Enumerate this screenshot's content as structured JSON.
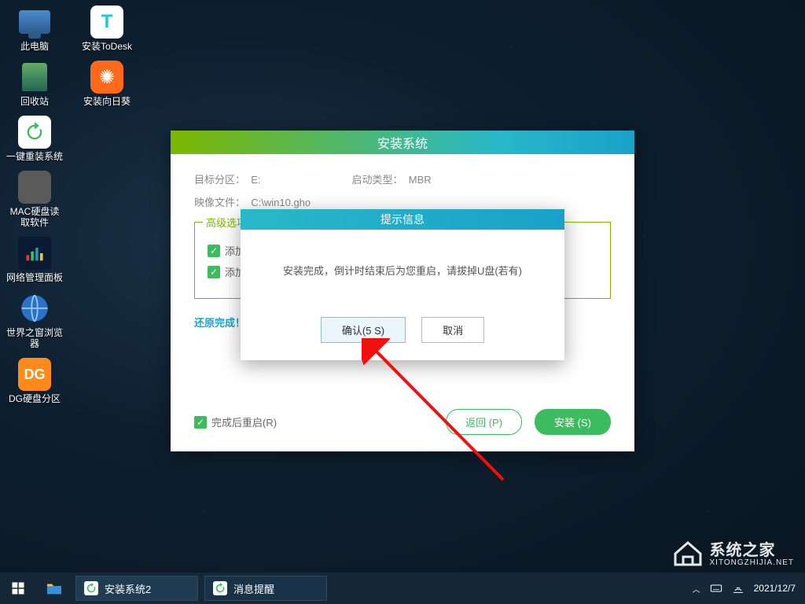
{
  "desktop": {
    "icons": [
      {
        "label": "此电脑"
      },
      {
        "label": "安装ToDesk"
      },
      {
        "label": "回收站"
      },
      {
        "label": "安装向日葵"
      },
      {
        "label": "一键重装系统"
      },
      {
        "label": "MAC硬盘读\n取软件"
      },
      {
        "label": "网络管理面板"
      },
      {
        "label": "世界之窗浏览\n器"
      },
      {
        "label": "DG硬盘分区"
      }
    ]
  },
  "installer": {
    "title": "安装系统",
    "target_partition_label": "目标分区：",
    "target_partition_value": "E:",
    "boot_type_label": "启动类型：",
    "boot_type_value": "MBR",
    "image_file_label": "映像文件：",
    "image_file_value": "C:\\win10.gho",
    "advanced_title": "高级选项",
    "chk1": "添加引导",
    "chk2": "添加驱动",
    "restore_done": "还原完成！",
    "restart_after": "完成后重启(R)",
    "back_btn": "返回 (P)",
    "install_btn": "安装 (S)"
  },
  "prompt": {
    "title": "提示信息",
    "message": "安装完成，倒计时结束后为您重启，请拔掉U盘(若有)",
    "ok": "确认(5 S)",
    "cancel": "取消"
  },
  "taskbar": {
    "tasks": [
      {
        "label": "安装系统2"
      },
      {
        "label": "消息提醒"
      }
    ]
  },
  "tray": {
    "date": "2021/12/7"
  },
  "watermark": {
    "title": "系统之家",
    "sub": "XITONGZHIJIA.NET"
  }
}
